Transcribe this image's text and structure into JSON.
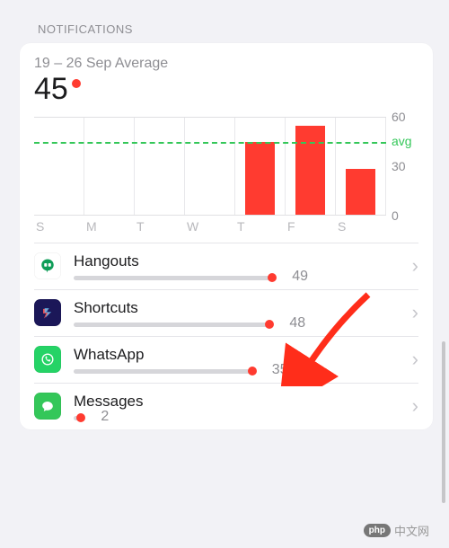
{
  "section_header": "NOTIFICATIONS",
  "summary": {
    "date_range": "19 – 26 Sep Average",
    "value": "45"
  },
  "chart_data": {
    "type": "bar",
    "categories": [
      "S",
      "M",
      "T",
      "W",
      "T",
      "F",
      "S"
    ],
    "values": [
      0,
      0,
      0,
      0,
      45,
      55,
      28
    ],
    "title": "",
    "xlabel": "",
    "ylabel": "",
    "ylim": [
      0,
      60
    ],
    "avg": 45,
    "y_ticks": [
      60,
      30,
      0
    ],
    "avg_label": "avg"
  },
  "apps": [
    {
      "name": "Hangouts",
      "count": 49,
      "icon_bg": "#ffffff",
      "icon_fg": "#0f9d58",
      "pct": 79
    },
    {
      "name": "Shortcuts",
      "count": 48,
      "icon_bg": "#1b1758",
      "icon_fg": "#ffffff",
      "pct": 78
    },
    {
      "name": "WhatsApp",
      "count": 35,
      "icon_bg": "#25d366",
      "icon_fg": "#ffffff",
      "pct": 71
    },
    {
      "name": "Messages",
      "count": 2,
      "icon_bg": "#34c759",
      "icon_fg": "#ffffff",
      "pct": 3
    }
  ],
  "footer": "中文网"
}
